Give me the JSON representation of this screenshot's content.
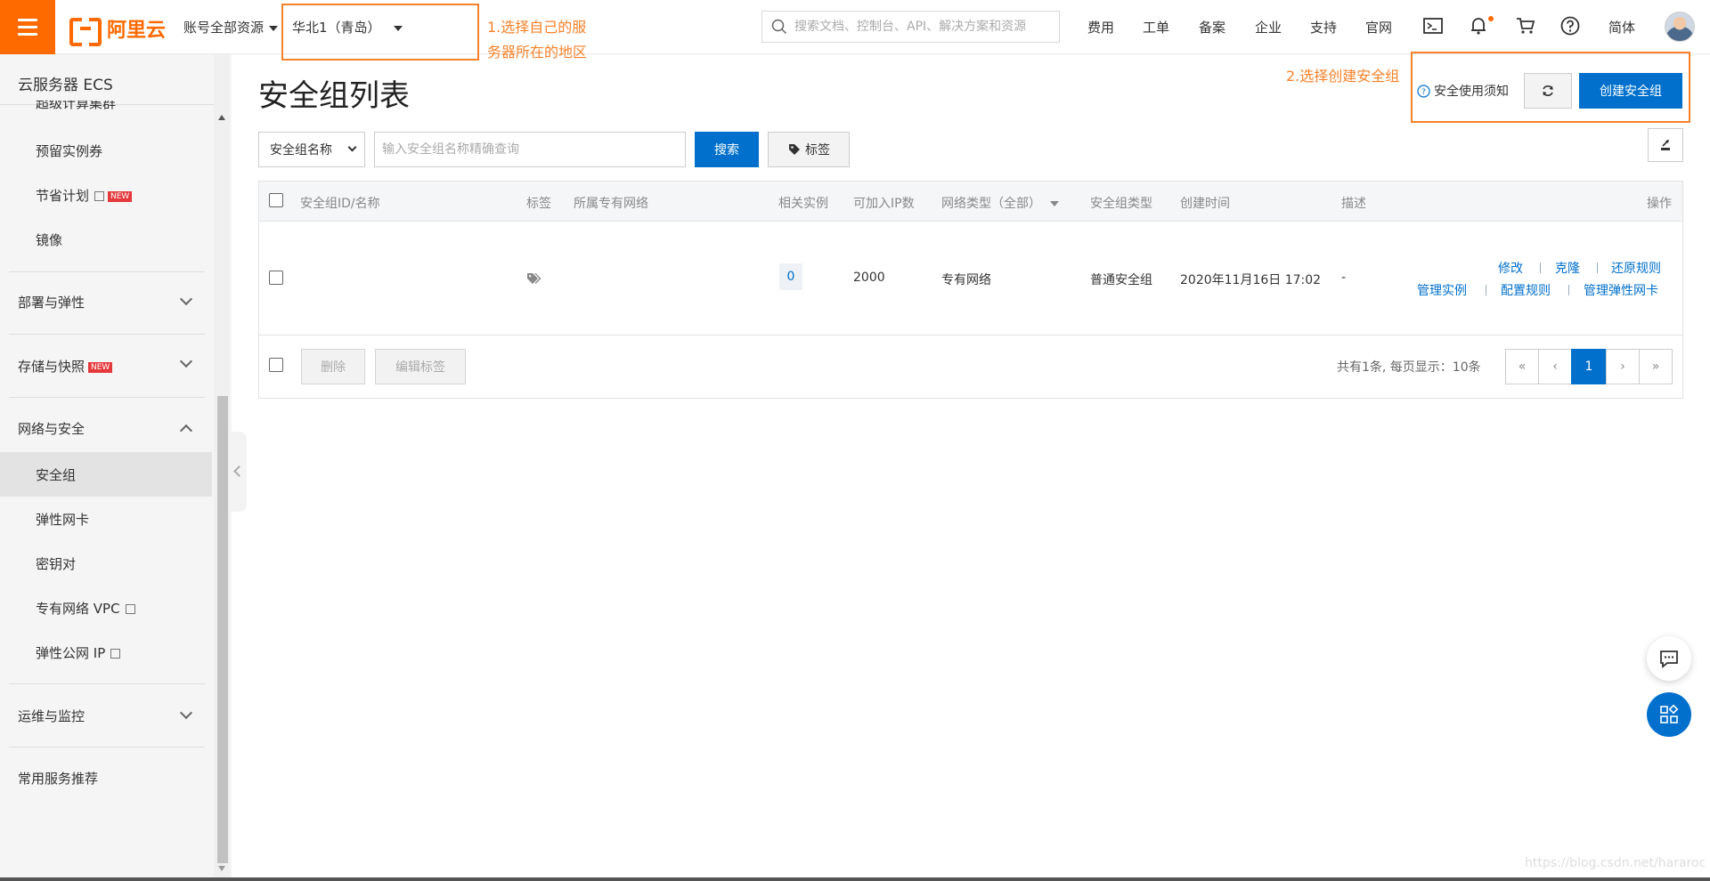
{
  "topbar": {
    "logo_text": "阿里云",
    "account_label": "账号全部资源",
    "region_label": "华北1（青岛）",
    "search_placeholder": "搜索文档、控制台、API、解决方案和资源",
    "nav": [
      "费用",
      "工单",
      "备案",
      "企业",
      "支持",
      "官网"
    ],
    "lang_label": "简体",
    "icons": [
      "terminal-icon",
      "bell-icon",
      "cart-icon",
      "help-icon"
    ]
  },
  "annotations": {
    "region_note_line1": "1.选择自己的服",
    "region_note_line2": "务器所在的地区",
    "create_note": "2.选择创建安全组"
  },
  "sidebar": {
    "title": "云服务器 ECS",
    "cut_item": "超级计算集群",
    "items_top": [
      "预留实例券",
      "节省计划",
      "镜像"
    ],
    "new_badge": "NEW",
    "groups": {
      "deploy": "部署与弹性",
      "storage": "存储与快照",
      "network": "网络与安全",
      "ops": "运维与监控",
      "recommend": "常用服务推荐"
    },
    "network_items": [
      "安全组",
      "弹性网卡",
      "密钥对",
      "专有网络 VPC",
      "弹性公网 IP"
    ]
  },
  "main": {
    "title": "安全组列表",
    "safety_notice": "安全使用须知",
    "create_button": "创建安全组",
    "filter_select": "安全组名称",
    "query_placeholder": "输入安全组名称精确查询",
    "search_button": "搜索",
    "tag_button": "标签"
  },
  "table": {
    "headers": {
      "id_name": "安全组ID/名称",
      "tag": "标签",
      "vpc": "所属专有网络",
      "instances": "相关实例",
      "ip_capacity": "可加入IP数",
      "network_type": "网络类型（全部）",
      "group_type": "安全组类型",
      "created": "创建时间",
      "description": "描述",
      "actions": "操作"
    },
    "row": {
      "instances": "0",
      "ip_capacity": "2000",
      "network_type": "专有网络",
      "group_type": "普通安全组",
      "created": "2020年11月16日 17:02",
      "description": "-",
      "actions_line1": [
        "修改",
        "克隆",
        "还原规则"
      ],
      "actions_line2": [
        "管理实例",
        "配置规则",
        "管理弹性网卡"
      ]
    },
    "footer": {
      "delete_button": "删除",
      "edit_tags_button": "编辑标签",
      "summary": "共有1条, 每页显示：10条",
      "pager": [
        "«",
        "‹",
        "1",
        "›",
        "»"
      ]
    }
  },
  "watermark": "https://blog.csdn.net/hararoc",
  "colors": {
    "brand_orange": "#ff6a00",
    "primary_blue": "#0070cc",
    "annotation_orange": "#f5822a"
  }
}
